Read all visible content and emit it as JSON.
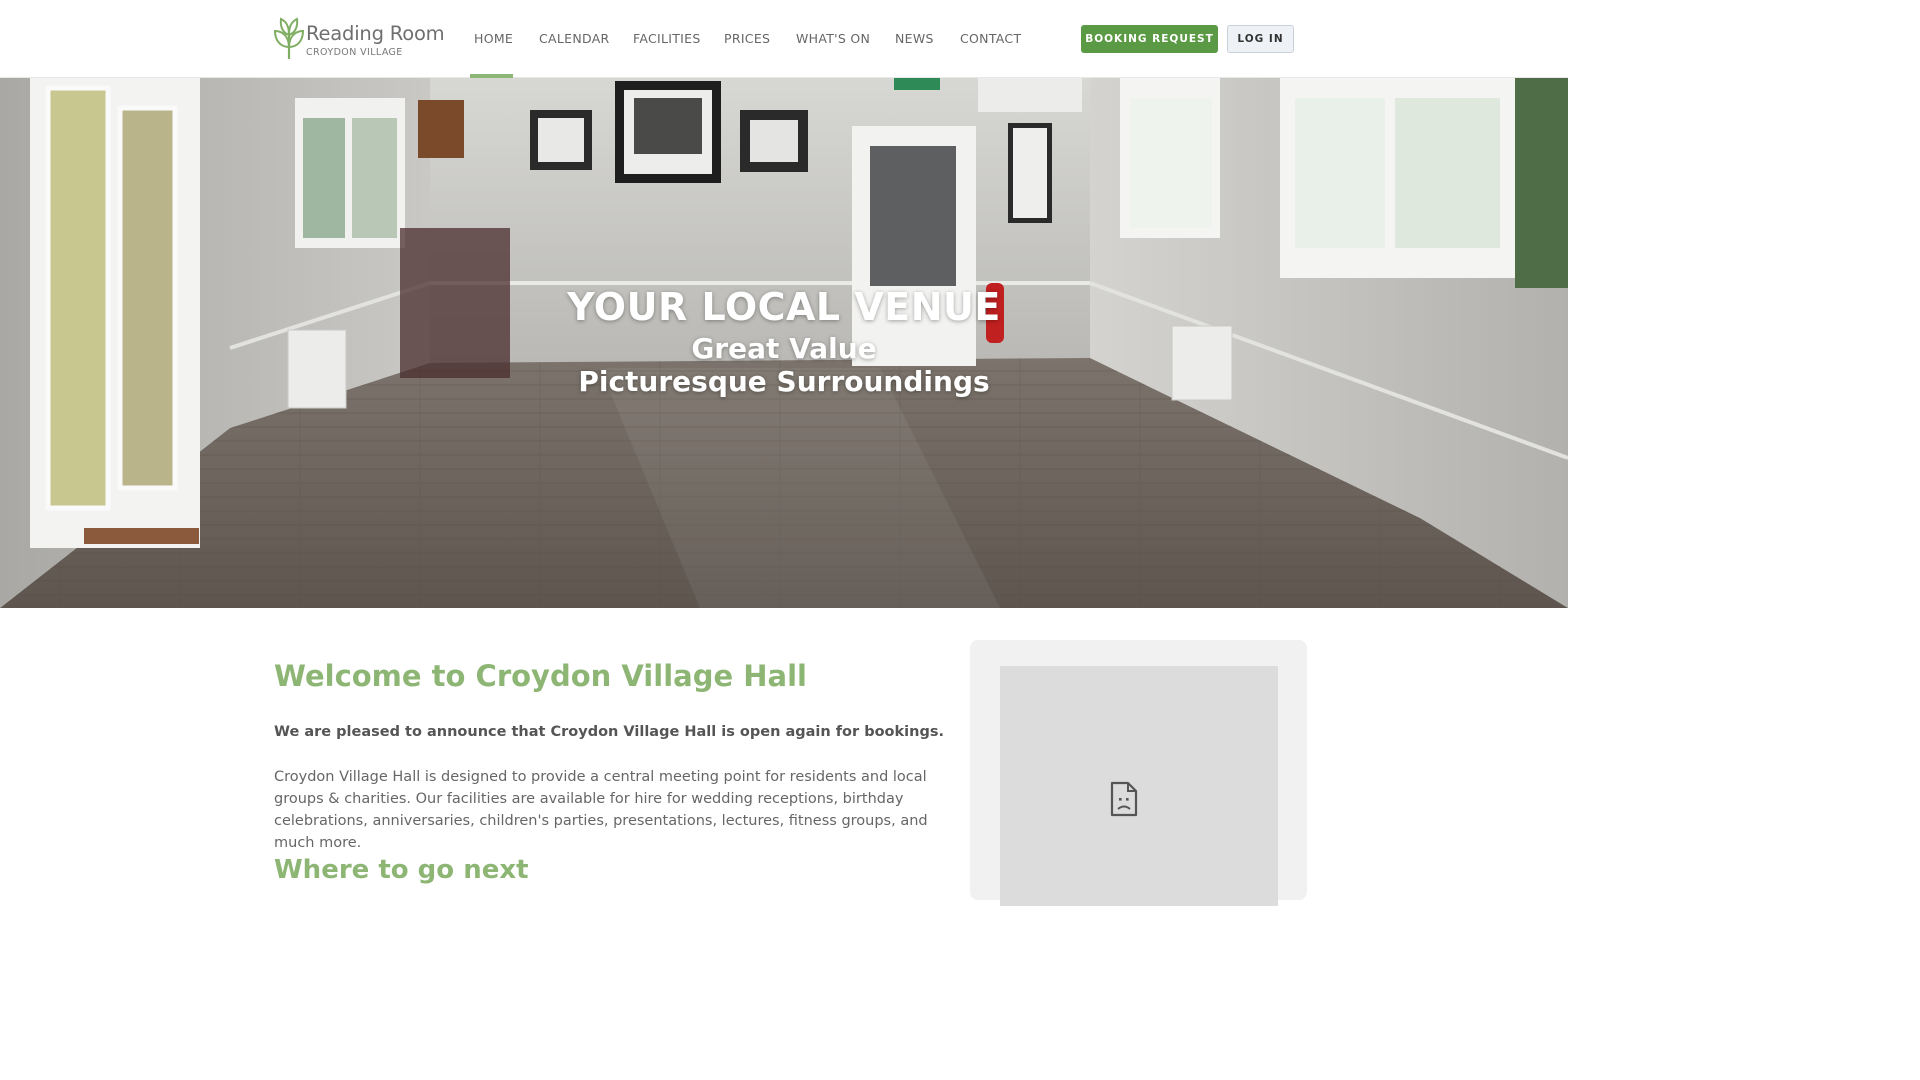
{
  "logo": {
    "title": "Reading Room",
    "subtitle": "CROYDON VILLAGE",
    "icon": "sprout-icon"
  },
  "nav": {
    "items": [
      {
        "label": "HOME",
        "active": true
      },
      {
        "label": "CALENDAR",
        "active": false
      },
      {
        "label": "FACILITIES",
        "active": false
      },
      {
        "label": "PRICES",
        "active": false
      },
      {
        "label": "WHAT'S ON",
        "active": false
      },
      {
        "label": "NEWS",
        "active": false
      },
      {
        "label": "CONTACT",
        "active": false
      }
    ],
    "booking_label": "BOOKING REQUEST",
    "login_label": "LOG IN"
  },
  "hero": {
    "title": "YOUR LOCAL VENUE",
    "line1": "Great Value",
    "line2": "Picturesque Surroundings"
  },
  "main": {
    "heading": "Welcome to Croydon Village Hall",
    "announcement": "We are pleased to announce that Croydon Village Hall is open again for bookings.",
    "paragraph": "Croydon Village Hall is designed to provide a central meeting point for residents and local groups & charities. Our facilities are available for hire for wedding receptions, birthday celebrations, anniversaries, children's parties, presentations, lectures, fitness groups, and much more.",
    "subheading": "Where to go next"
  },
  "sidebar": {
    "embed_icon": "broken-page-icon"
  },
  "colors": {
    "brand_green": "#8db675",
    "button_green": "#5b9a44"
  }
}
